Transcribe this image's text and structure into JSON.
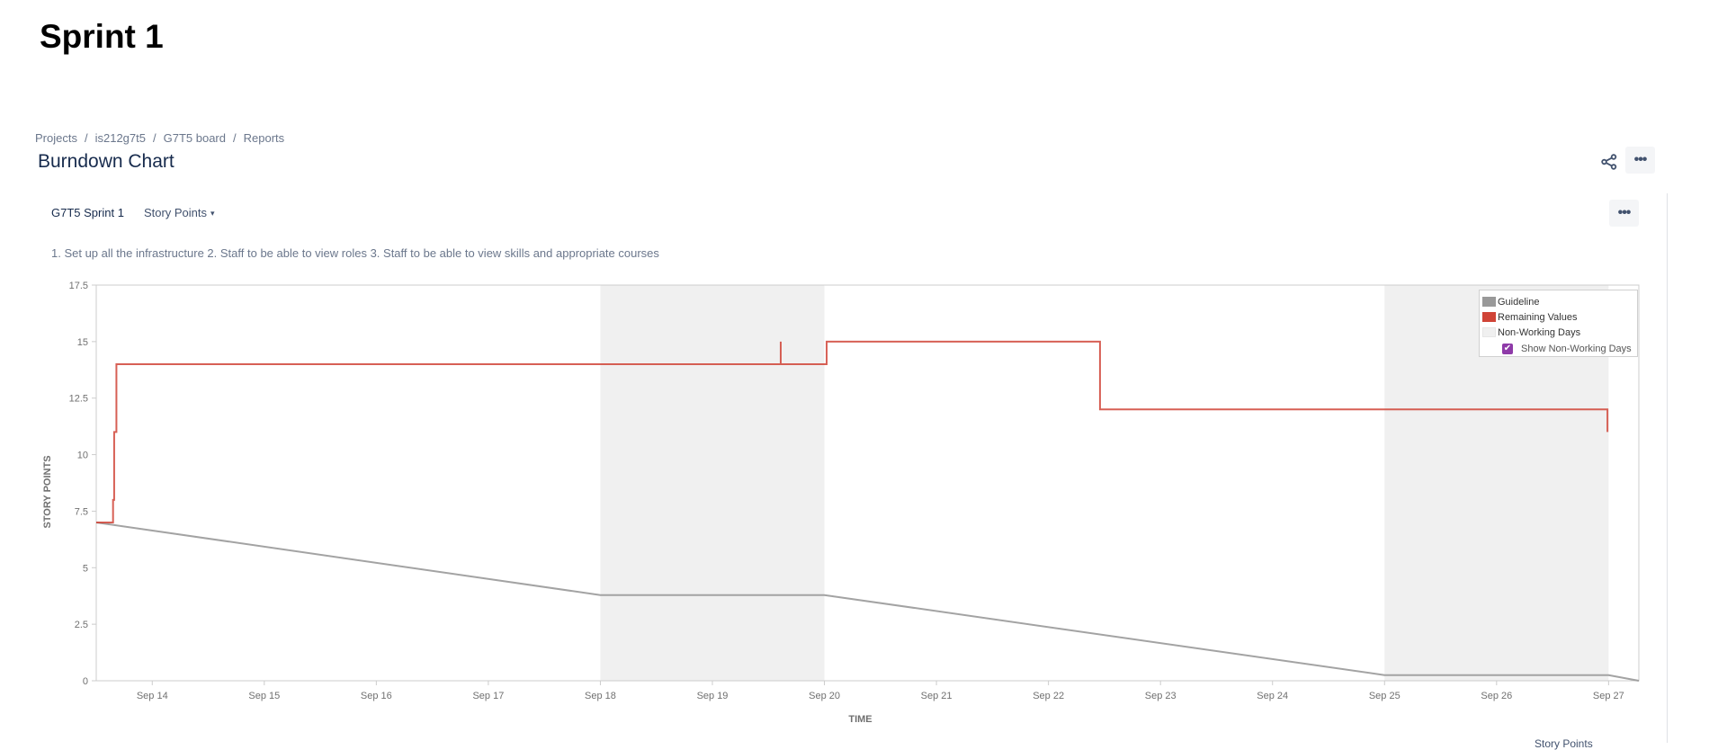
{
  "page": {
    "title": "Sprint 1"
  },
  "breadcrumb": [
    "Projects",
    "is212g7t5",
    "G7T5 board",
    "Reports"
  ],
  "report": {
    "title": "Burndown Chart"
  },
  "header_actions": {
    "share_icon": "share-icon",
    "more_icon": "more-icon"
  },
  "toolbar": {
    "sprint": "G7T5 Sprint 1",
    "estimation": "Story Points",
    "estimation_caret": "▾",
    "more_icon": "more-icon"
  },
  "sprint_goal": "1. Set up all the infrastructure 2. Staff to be able to view roles 3. Staff to be able to view skills and appropriate courses",
  "legend": {
    "items": [
      {
        "label": "Guideline",
        "color": "#999999"
      },
      {
        "label": "Remaining Values",
        "color": "#d04437"
      },
      {
        "label": "Non-Working Days",
        "color": "#f0f0f0"
      }
    ],
    "toggle": {
      "label": "Show Non-Working Days",
      "checked": true,
      "mark": "✔"
    }
  },
  "footer_cutoff": "Story Points",
  "colors": {
    "guideline": "#999999",
    "remaining": "#d04437",
    "non_working": "#f0f0f0",
    "axis": "#cccccc"
  },
  "chart_data": {
    "type": "line",
    "title": "Burndown Chart",
    "xlabel": "TIME",
    "ylabel": "STORY POINTS",
    "x_unit": "day of September",
    "xlim": [
      13.5,
      27.27
    ],
    "ylim": [
      0,
      17.5
    ],
    "yticks": [
      0,
      2.5,
      5,
      7.5,
      10,
      12.5,
      15,
      17.5
    ],
    "ytick_labels": [
      "0",
      "2.5",
      "5",
      "7.5",
      "10",
      "12.5",
      "15",
      "17.5"
    ],
    "xticks": [
      14,
      15,
      16,
      17,
      18,
      19,
      20,
      21,
      22,
      23,
      24,
      25,
      26,
      27
    ],
    "xtick_labels": [
      "Sep 14",
      "Sep 15",
      "Sep 16",
      "Sep 17",
      "Sep 18",
      "Sep 19",
      "Sep 20",
      "Sep 21",
      "Sep 22",
      "Sep 23",
      "Sep 24",
      "Sep 25",
      "Sep 26",
      "Sep 27"
    ],
    "grid": false,
    "legend_position": "top-right",
    "non_working_periods": [
      [
        18,
        20
      ],
      [
        25,
        27
      ]
    ],
    "series": [
      {
        "name": "Guideline",
        "step": false,
        "points": [
          [
            13.5,
            7
          ],
          [
            18,
            3.79
          ],
          [
            20,
            3.79
          ],
          [
            25,
            0.25
          ],
          [
            27,
            0.25
          ],
          [
            27.27,
            0
          ]
        ]
      },
      {
        "name": "Remaining Values",
        "step": true,
        "points": [
          [
            13.5,
            7
          ],
          [
            13.65,
            8
          ],
          [
            13.66,
            11
          ],
          [
            13.68,
            14
          ],
          [
            19.61,
            15
          ],
          [
            19.61,
            14
          ],
          [
            20.02,
            15
          ],
          [
            22.46,
            12
          ],
          [
            26.99,
            11
          ]
        ]
      }
    ]
  }
}
